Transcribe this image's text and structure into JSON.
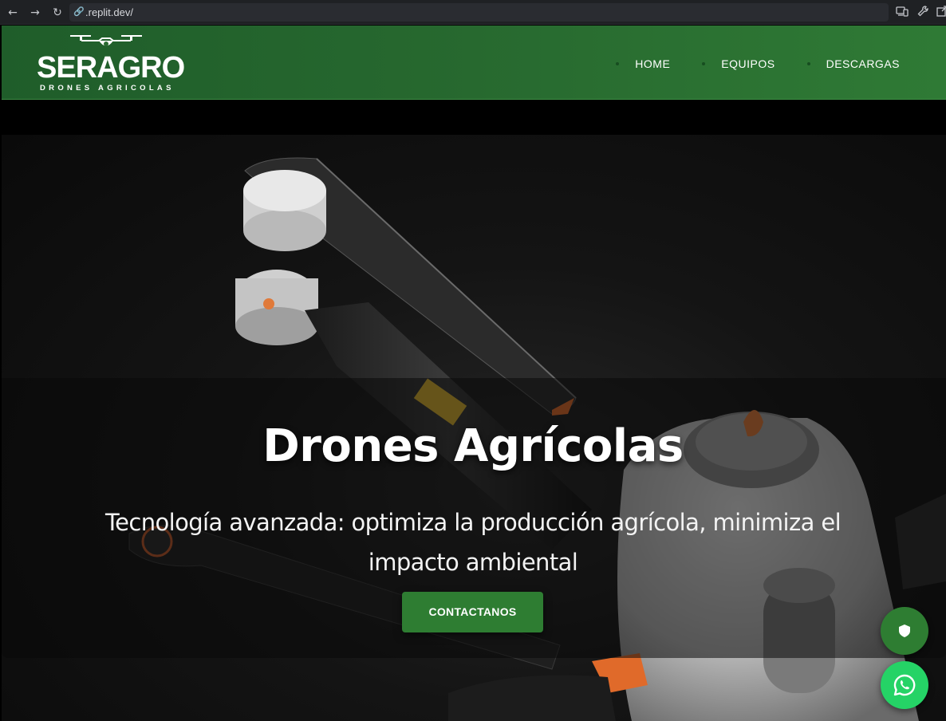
{
  "browser": {
    "url": ".replit.dev/",
    "back_glyph": "←",
    "forward_glyph": "→",
    "reload_glyph": "↻",
    "link_glyph": "🔗",
    "icons": [
      "devices-icon",
      "wrench-icon",
      "open-external-icon"
    ]
  },
  "header": {
    "logo": {
      "word": "SERAGRO",
      "tagline": "DRONES AGRICOLAS"
    },
    "nav": [
      {
        "label": "HOME"
      },
      {
        "label": "EQUIPOS"
      },
      {
        "label": "DESCARGAS"
      }
    ]
  },
  "hero": {
    "title": "Drones Agrícolas",
    "subtitle": "Tecnología avanzada: optimiza la producción agrícola, minimiza el impacto ambiental",
    "cta_label": "CONTACTANOS"
  },
  "floating_buttons": {
    "shield": "shield-icon",
    "whatsapp": "whatsapp-icon"
  },
  "colors": {
    "header_green": "#27692f",
    "cta_green": "#2e7d32",
    "whatsapp_green": "#25d366"
  }
}
